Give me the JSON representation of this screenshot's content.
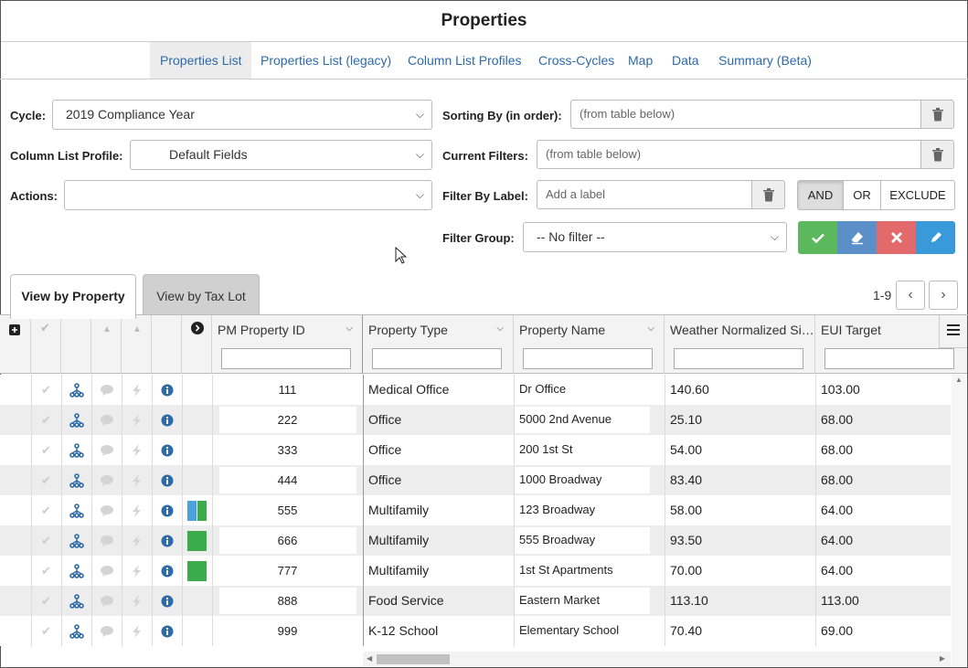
{
  "page_title": "Properties",
  "nav": {
    "items": [
      "Properties List",
      "Properties List (legacy)",
      "Column List Profiles",
      "Cross-Cycles",
      "Map",
      "Data",
      "Summary (Beta)"
    ],
    "active": "Properties List"
  },
  "filters": {
    "cycle_label": "Cycle:",
    "cycle_value": "2019 Compliance Year",
    "profile_label": "Column List Profile:",
    "profile_value": "Default Fields",
    "actions_label": "Actions:",
    "actions_value": "",
    "sorting_label": "Sorting By (in order):",
    "sorting_value": "(from table below)",
    "current_filters_label": "Current Filters:",
    "current_filters_value": "(from table below)",
    "filter_label_label": "Filter By Label:",
    "filter_label_placeholder": "Add a label",
    "logic": [
      "AND",
      "OR",
      "EXCLUDE"
    ],
    "logic_active": "AND",
    "filter_group_label": "Filter Group:",
    "filter_group_value": "-- No filter --"
  },
  "action_colors": {
    "apply": "#5cb85c",
    "clear": "#5b8fc7",
    "delete": "#e26a6a",
    "edit": "#3a9ad9"
  },
  "tabs": [
    "View by Property",
    "View by Tax Lot"
  ],
  "active_tab": "View by Property",
  "pager": {
    "range": "1-9"
  },
  "table": {
    "columns": [
      "PM Property ID",
      "Property Type",
      "Property Name",
      "Weather Normalized Si…",
      "EUI Target"
    ],
    "rows": [
      {
        "pm_id": "111",
        "type": "Medical Office",
        "name": "Dr Office",
        "wn": "140.60",
        "eui": "103.00",
        "labels": []
      },
      {
        "pm_id": "222",
        "type": "Office",
        "name": "5000 2nd Avenue",
        "wn": "25.10",
        "eui": "68.00",
        "labels": []
      },
      {
        "pm_id": "333",
        "type": "Office",
        "name": "200 1st St",
        "wn": "54.00",
        "eui": "68.00",
        "labels": []
      },
      {
        "pm_id": "444",
        "type": "Office",
        "name": "1000 Broadway",
        "wn": "83.40",
        "eui": "68.00",
        "labels": []
      },
      {
        "pm_id": "555",
        "type": "Multifamily",
        "name": "123 Broadway",
        "wn": "58.00",
        "eui": "64.00",
        "labels": [
          "#4aa3df",
          "#3cab4a"
        ]
      },
      {
        "pm_id": "666",
        "type": "Multifamily",
        "name": "555 Broadway",
        "wn": "93.50",
        "eui": "64.00",
        "labels": [
          "#3cab4a"
        ]
      },
      {
        "pm_id": "777",
        "type": "Multifamily",
        "name": "1st St Apartments",
        "wn": "70.00",
        "eui": "64.00",
        "labels": [
          "#3cab4a"
        ]
      },
      {
        "pm_id": "888",
        "type": "Food Service",
        "name": "Eastern Market",
        "wn": "113.10",
        "eui": "113.00",
        "labels": []
      },
      {
        "pm_id": "999",
        "type": "K-12 School",
        "name": "Elementary School",
        "wn": "70.40",
        "eui": "69.00",
        "labels": []
      }
    ]
  }
}
